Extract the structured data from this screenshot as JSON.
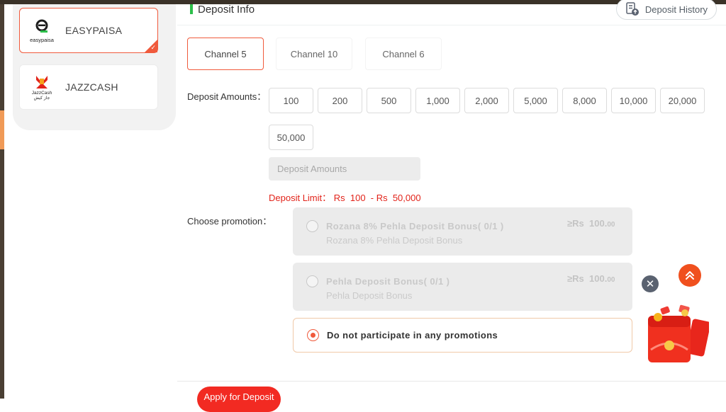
{
  "payment_methods": [
    {
      "name": "EASYPAISA",
      "logo_text": "easypaisa",
      "active": true
    },
    {
      "name": "JAZZCASH",
      "logo_text_top": "JazzCash",
      "logo_text_bottom": "جاز کیش",
      "active": false
    }
  ],
  "header": {
    "title": "Deposit Info",
    "history_label": "Deposit History"
  },
  "channels": [
    "Channel 5",
    "Channel 10",
    "Channel 6"
  ],
  "deposit": {
    "amounts_label": "Deposit Amounts：",
    "amounts": [
      "100",
      "200",
      "500",
      "1,000",
      "2,000",
      "5,000",
      "8,000",
      "10,000",
      "20,000",
      "50,000"
    ],
    "input_placeholder": "Deposit Amounts",
    "limit_text": "Deposit Limit： Rs  100  - Rs  50,000"
  },
  "promotion": {
    "label": "Choose promotion：",
    "options": [
      {
        "title": "Rozana 8% Pehla Deposit Bonus( 0/1 )",
        "subtitle": "Rozana 8% Pehla Deposit Bonus",
        "min_prefix": "≥Rs",
        "min_value": "100.",
        "min_decimals": "00"
      },
      {
        "title": "Pehla Deposit Bonus( 0/1 )",
        "subtitle": "Pehla Deposit Bonus",
        "min_prefix": "≥Rs",
        "min_value": "100.",
        "min_decimals": "00"
      },
      {
        "title": "Do not participate in any promotions"
      }
    ]
  },
  "apply_button": "Apply for Deposit",
  "colors": {
    "accent": "#f05a3c",
    "green_bar": "#2cbf4a",
    "limit_red": "#e2231a"
  },
  "icons": [
    "easypaisa-logo",
    "jazzcash-logo",
    "history-icon",
    "close-icon",
    "scroll-top-icon",
    "gift-envelope-icon"
  ]
}
